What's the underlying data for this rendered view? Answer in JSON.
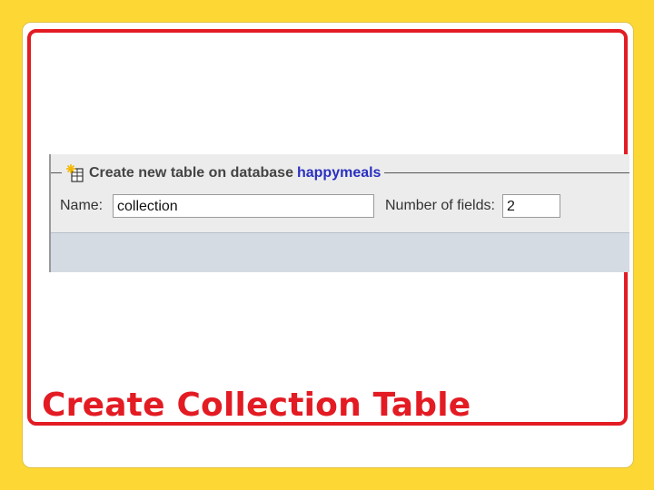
{
  "colors": {
    "background": "#fdd835",
    "accent": "#e31b23",
    "database_link": "#2a2fbf"
  },
  "panel": {
    "legend_text": "Create new table on database",
    "database_name": "happymeals",
    "icon": "new-table-icon"
  },
  "form": {
    "name_label": "Name:",
    "name_value": "collection",
    "fields_label": "Number of fields:",
    "fields_value": "2"
  },
  "slide": {
    "title": "Create Collection Table"
  }
}
